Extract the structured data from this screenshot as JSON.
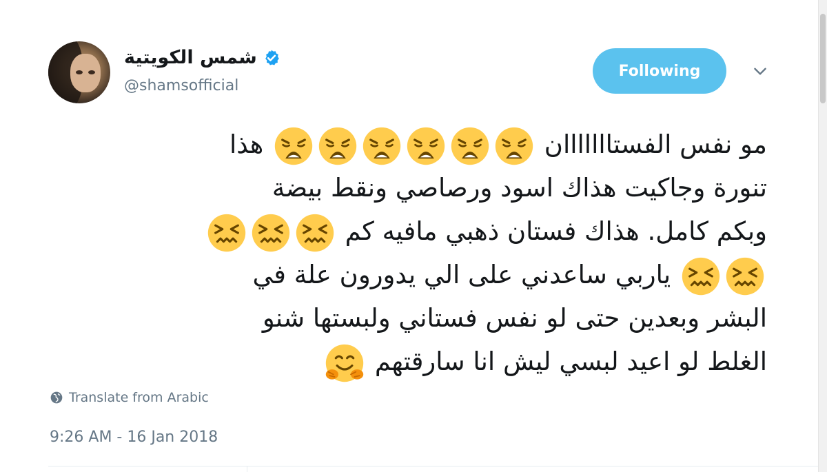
{
  "user": {
    "display_name": "شمس الكويتية",
    "handle": "@shamsofficial",
    "verified": true
  },
  "follow_button": {
    "label": "Following"
  },
  "tweet": {
    "lines": [
      [
        "مو نفس الفستااااااان ",
        "emoji:weary",
        "emoji:weary",
        "emoji:weary",
        "emoji:weary",
        "emoji:weary",
        "emoji:weary",
        " هذا"
      ],
      [
        "تنورة وجاكيت هذاك اسود ورصاصي ونقط بيضة"
      ],
      [
        "وبكم كامل. هذاك فستان ذهبي مافيه كم ",
        "emoji:confounded",
        "emoji:confounded",
        "emoji:confounded"
      ],
      [
        "emoji:confounded",
        "emoji:confounded",
        " ياربي ساعدني على الي يدورون علة في"
      ],
      [
        "البشر وبعدين حتى لو نفس فستاني ولبستها شنو"
      ],
      [
        "الغلط لو اعيد لبسي ليش انا سارقتهم ",
        "emoji:hugging"
      ]
    ]
  },
  "translate": {
    "label": "Translate from Arabic",
    "icon": "globe-icon"
  },
  "timestamp": "9:26 AM - 16 Jan 2018",
  "colors": {
    "accent": "#5bc2ee",
    "verified": "#1da1f2",
    "muted": "#657786",
    "emoji_face": "#ffcc4d"
  }
}
